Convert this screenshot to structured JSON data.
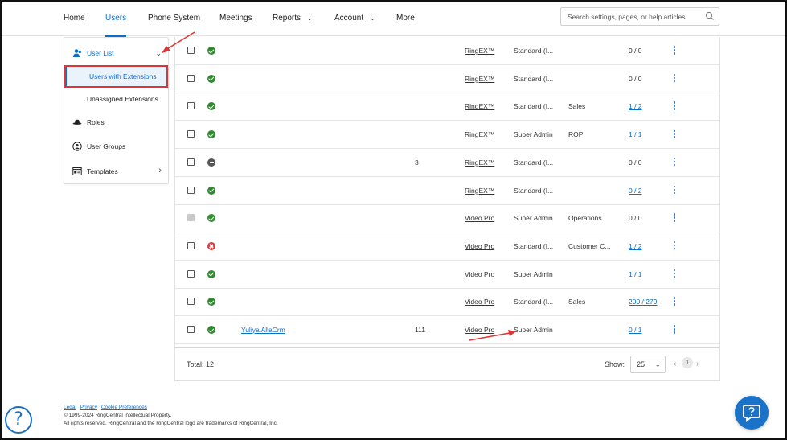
{
  "nav": {
    "items": [
      {
        "label": "Home"
      },
      {
        "label": "Users"
      },
      {
        "label": "Phone System"
      },
      {
        "label": "Meetings"
      },
      {
        "label": "Reports"
      },
      {
        "label": "Account"
      },
      {
        "label": "More"
      }
    ],
    "active": "Users",
    "search_placeholder": "Search settings, pages, or help articles"
  },
  "sidebar": {
    "user_list": "User List",
    "sub_items": [
      {
        "label": "Users with Extensions",
        "active": true
      },
      {
        "label": "Unassigned Extensions",
        "active": false
      }
    ],
    "items": [
      {
        "label": "Roles",
        "icon": "hat-icon"
      },
      {
        "label": "User Groups",
        "icon": "user-groups-icon"
      },
      {
        "label": "Templates",
        "icon": "templates-icon"
      }
    ]
  },
  "table": {
    "rows": [
      {
        "status": "ok",
        "name": "",
        "ext": "",
        "plan": "RingEX™",
        "role": "Standard (I...",
        "dept": "",
        "devices": "0 / 0",
        "devices_link": false
      },
      {
        "status": "ok",
        "name": "",
        "ext": "",
        "plan": "RingEX™",
        "role": "Standard (I...",
        "dept": "",
        "devices": "0 / 0",
        "devices_link": false
      },
      {
        "status": "ok",
        "name": "",
        "ext": "",
        "plan": "RingEX™",
        "role": "Standard (I...",
        "dept": "Sales",
        "devices": "1 / 2",
        "devices_link": true
      },
      {
        "status": "ok",
        "name": "",
        "ext": "",
        "plan": "RingEX™",
        "role": "Super Admin",
        "dept": "ROP",
        "devices": "1 / 1",
        "devices_link": true
      },
      {
        "status": "off",
        "name": "",
        "ext": "3",
        "plan": "RingEX™",
        "role": "Standard (I...",
        "dept": "",
        "devices": "0 / 0",
        "devices_link": false
      },
      {
        "status": "ok",
        "name": "",
        "ext": "",
        "plan": "RingEX™",
        "role": "Standard (I...",
        "dept": "",
        "devices": "0 / 2",
        "devices_link": true
      },
      {
        "status": "ok",
        "name": "",
        "ext": "",
        "plan": "Video Pro",
        "role": "Super Admin",
        "dept": "Operations",
        "devices": "0 / 0",
        "devices_link": false,
        "disabled_checkbox": true
      },
      {
        "status": "err",
        "name": "",
        "ext": "",
        "plan": "Video Pro",
        "role": "Standard (I...",
        "dept": "Customer C...",
        "devices": "1 / 2",
        "devices_link": true
      },
      {
        "status": "ok",
        "name": "",
        "ext": "",
        "plan": "Video Pro",
        "role": "Super Admin",
        "dept": "",
        "devices": "1 / 1",
        "devices_link": true
      },
      {
        "status": "ok",
        "name": "",
        "ext": "",
        "plan": "Video Pro",
        "role": "Standard (I...",
        "dept": "Sales",
        "devices": "200 / 279",
        "devices_link": true
      },
      {
        "status": "ok",
        "name": "Yuliya AllaCrm",
        "ext": "111",
        "plan": "Video Pro",
        "role": "Super Admin",
        "dept": "",
        "devices": "0 / 1",
        "devices_link": true
      }
    ],
    "total": "Total: 12",
    "show_label": "Show:",
    "page_size": "25",
    "current_page": "1"
  },
  "footer": {
    "links": [
      "Legal",
      "Privacy",
      "Cookie Preferences"
    ],
    "copyright": "© 1999-2024 RingCentral Intellectual Property.",
    "rights": "All rights reserved. RingCentral and the RingCentral logo are trademarks of RingCentral, Inc."
  },
  "colors": {
    "accent": "#0a6ecc",
    "annotation": "#e03333"
  }
}
